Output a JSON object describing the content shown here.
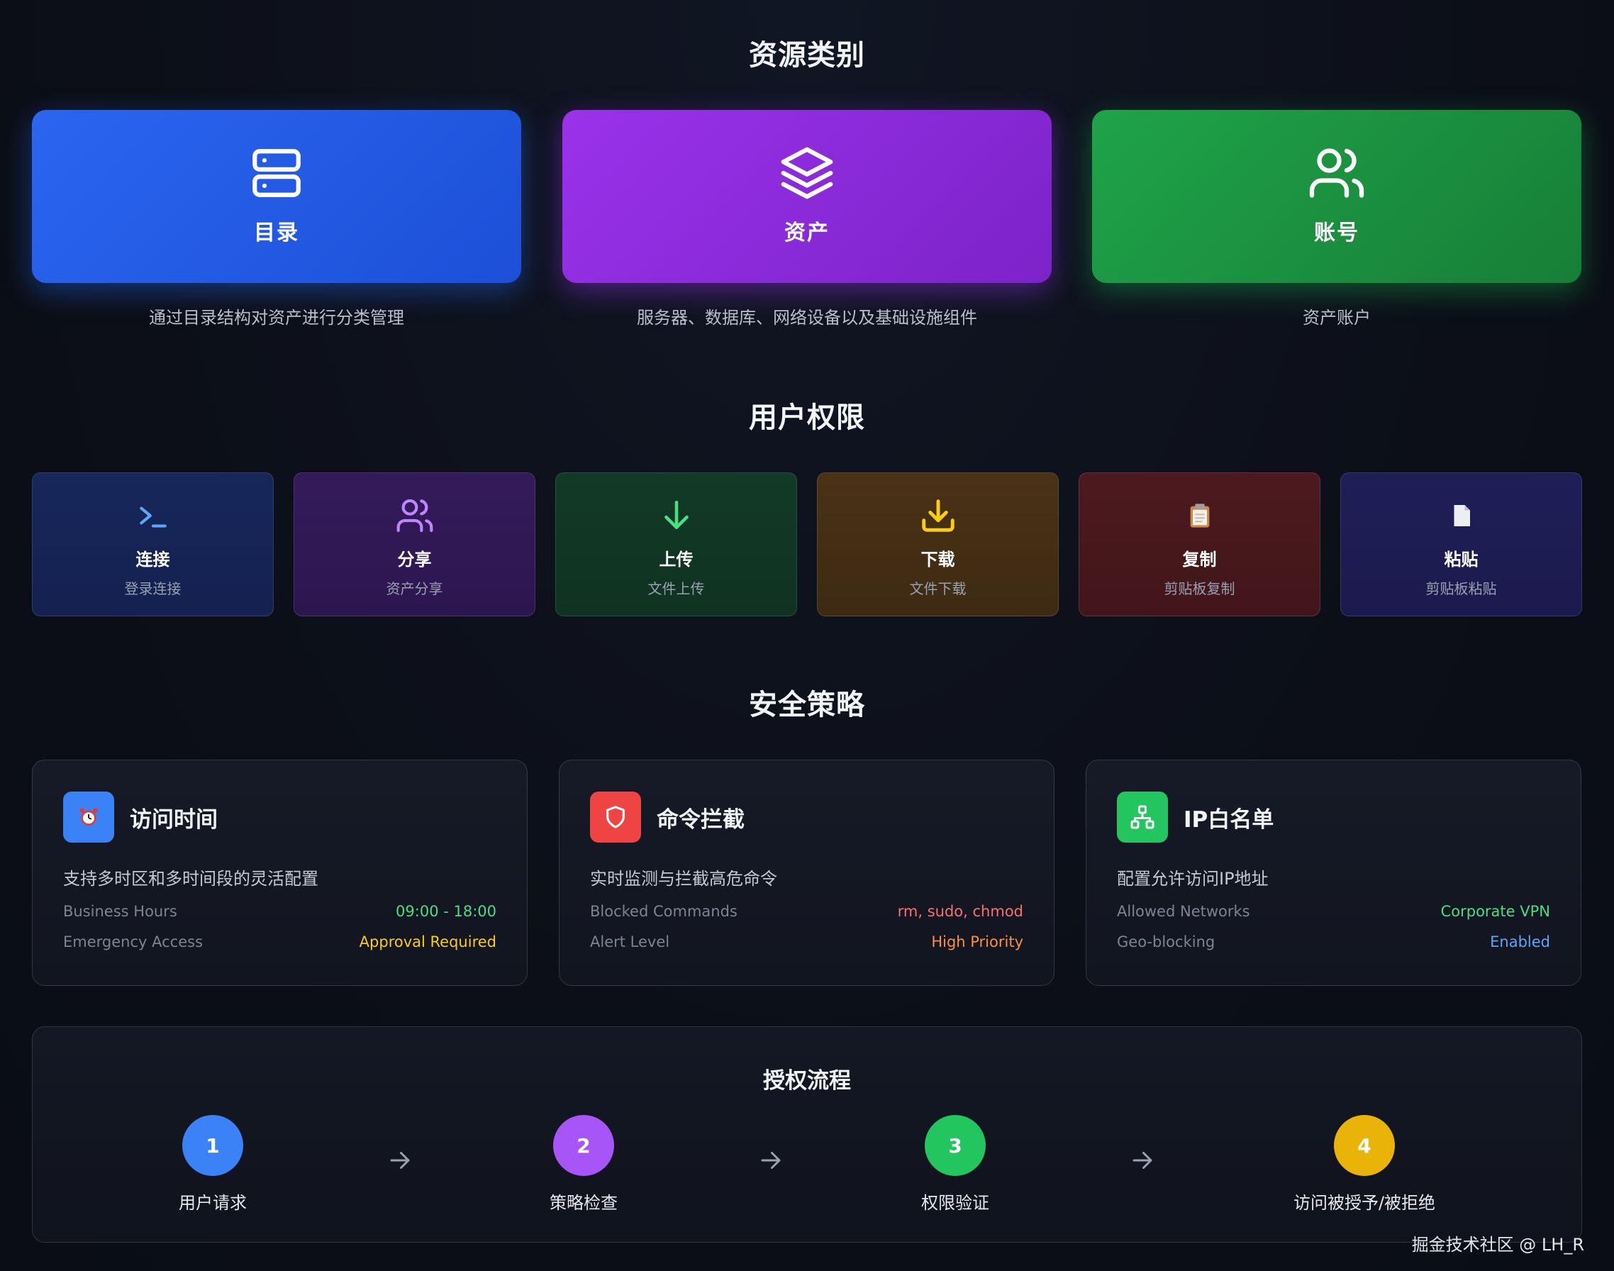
{
  "sections": {
    "categories": "资源类别",
    "permissions": "用户权限",
    "policies": "安全策略"
  },
  "categories": [
    {
      "label": "目录",
      "desc": "通过目录结构对资产进行分类管理",
      "icon": "server-icon",
      "color": "#2563eb"
    },
    {
      "label": "资产",
      "desc": "服务器、数据库、网络设备以及基础设施组件",
      "icon": "layers-icon",
      "color": "#9333ea"
    },
    {
      "label": "账号",
      "desc": "资产账户",
      "icon": "users-icon",
      "color": "#16a34a"
    }
  ],
  "permissions": [
    {
      "name": "连接",
      "sub": "登录连接",
      "icon": "terminal-icon",
      "color": "#60a5fa"
    },
    {
      "name": "分享",
      "sub": "资产分享",
      "icon": "users-icon",
      "color": "#c084fc"
    },
    {
      "name": "上传",
      "sub": "文件上传",
      "icon": "arrow-down-icon",
      "color": "#4ade80"
    },
    {
      "name": "下载",
      "sub": "文件下载",
      "icon": "download-icon",
      "color": "#facc15"
    },
    {
      "name": "复制",
      "sub": "剪贴板复制",
      "icon": "clipboard-icon",
      "color": "#f87171"
    },
    {
      "name": "粘贴",
      "sub": "剪贴板粘贴",
      "icon": "document-icon",
      "color": "#a5b4fc"
    }
  ],
  "policies": [
    {
      "title": "访问时间",
      "desc": "支持多时区和多时间段的灵活配置",
      "icon": "alarm-clock-icon",
      "icon_bg": "#3b82f6",
      "rows": [
        {
          "k": "Business Hours",
          "v": "09:00 - 18:00",
          "color": "#4ade80"
        },
        {
          "k": "Emergency Access",
          "v": "Approval Required",
          "color": "#facc15"
        }
      ]
    },
    {
      "title": "命令拦截",
      "desc": "实时监测与拦截高危命令",
      "icon": "shield-icon",
      "icon_bg": "#ef4444",
      "rows": [
        {
          "k": "Blocked Commands",
          "v": "rm, sudo, chmod",
          "color": "#f87171"
        },
        {
          "k": "Alert Level",
          "v": "High Priority",
          "color": "#fb923c"
        }
      ]
    },
    {
      "title": "IP白名单",
      "desc": "配置允许访问IP地址",
      "icon": "network-icon",
      "icon_bg": "#22c55e",
      "rows": [
        {
          "k": "Allowed Networks",
          "v": "Corporate VPN",
          "color": "#4ade80"
        },
        {
          "k": "Geo-blocking",
          "v": "Enabled",
          "color": "#60a5fa"
        }
      ]
    }
  ],
  "flow": {
    "title": "授权流程",
    "steps": [
      {
        "num": "1",
        "label": "用户请求",
        "color": "#3b82f6"
      },
      {
        "num": "2",
        "label": "策略检查",
        "color": "#a855f7"
      },
      {
        "num": "3",
        "label": "权限验证",
        "color": "#22c55e"
      },
      {
        "num": "4",
        "label": "访问被授予/被拒绝",
        "color": "#eab308"
      }
    ]
  },
  "watermark": "掘金技术社区 @ LH_R"
}
